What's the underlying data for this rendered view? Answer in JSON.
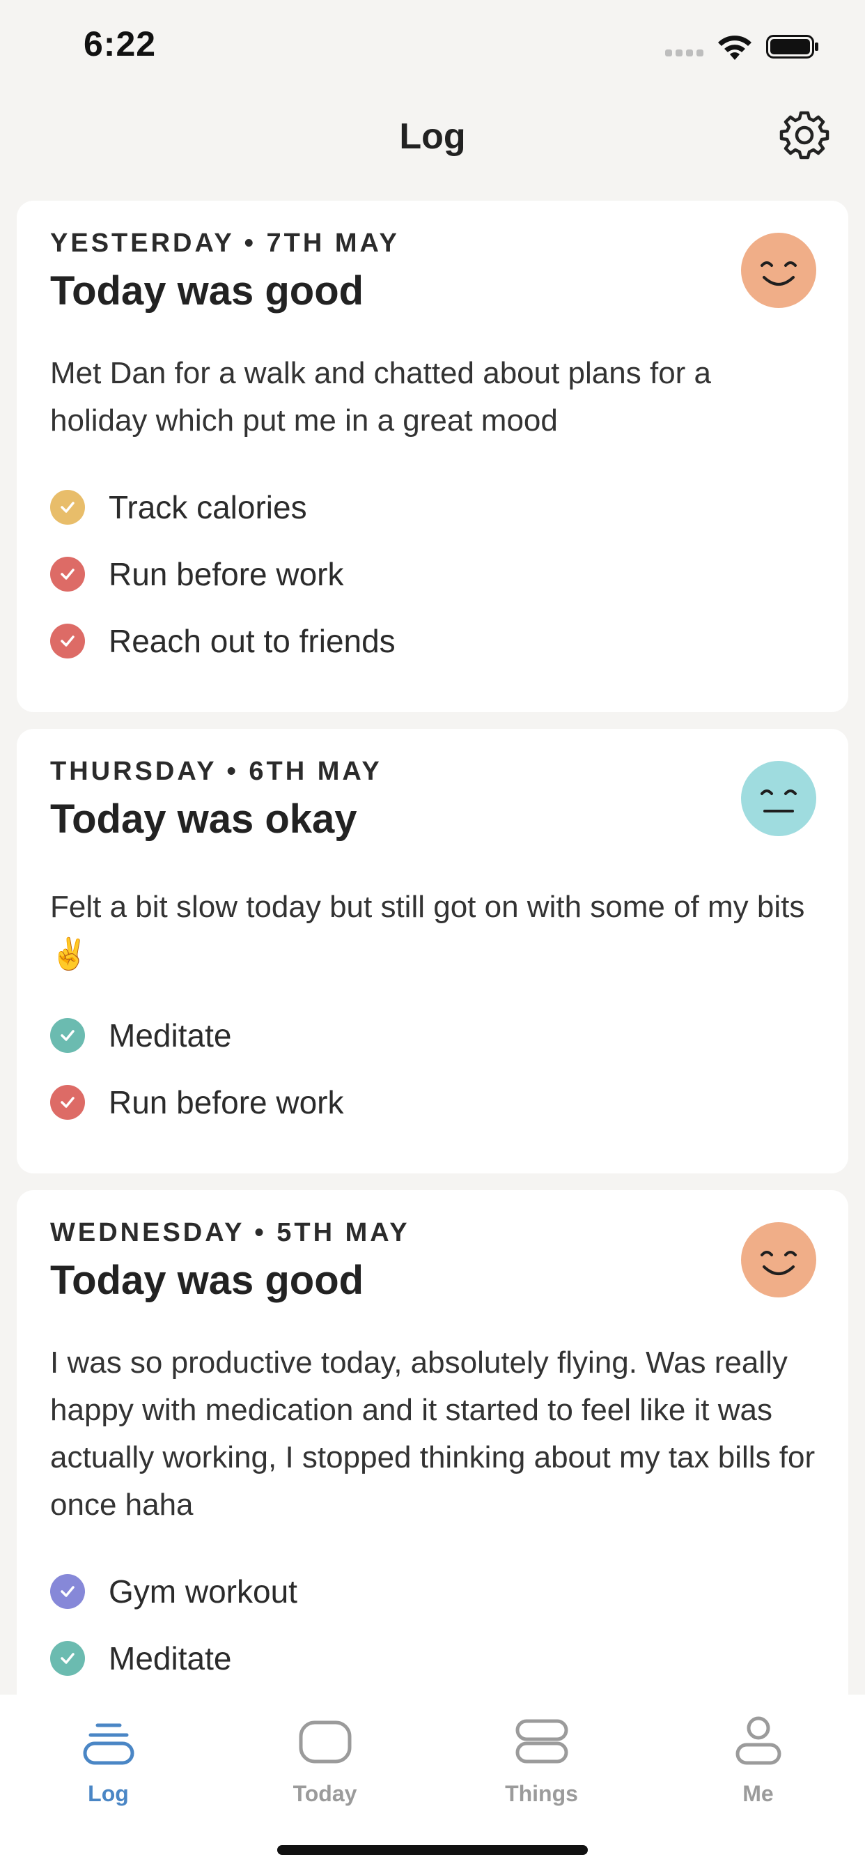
{
  "status_bar": {
    "time": "6:22"
  },
  "header": {
    "title": "Log",
    "settings_icon": "gear-icon"
  },
  "colors": {
    "face_good": "#f0ae88",
    "face_okay": "#9fdcdf",
    "check_yellow": "#e8bd6a",
    "check_red": "#dd6b66",
    "check_teal": "#6bbbb0",
    "check_purple": "#8688d8",
    "accent": "#4a86c5"
  },
  "entries": [
    {
      "date": "YESTERDAY • 7TH MAY",
      "title": "Today was good",
      "mood": "good",
      "note": "Met Dan for a walk and chatted about plans for a holiday which put me in a great mood",
      "habits": [
        {
          "label": "Track calories",
          "color": "yellow"
        },
        {
          "label": "Run before work",
          "color": "red"
        },
        {
          "label": "Reach out to friends",
          "color": "red"
        }
      ]
    },
    {
      "date": "THURSDAY • 6TH MAY",
      "title": "Today was okay",
      "mood": "okay",
      "note": "Felt a bit slow today but still got on with some of my bits ✌️",
      "habits": [
        {
          "label": "Meditate",
          "color": "teal"
        },
        {
          "label": "Run before work",
          "color": "red"
        }
      ]
    },
    {
      "date": "WEDNESDAY • 5TH MAY",
      "title": "Today was good",
      "mood": "good",
      "note": "I was so productive today, absolutely flying. Was really happy with medication and it started to feel like it was actually working, I stopped thinking about my tax bills for once haha",
      "habits": [
        {
          "label": "Gym workout",
          "color": "purple"
        },
        {
          "label": "Meditate",
          "color": "teal"
        }
      ]
    }
  ],
  "tabs": [
    {
      "label": "Log",
      "icon": "log-stack-icon",
      "active": true
    },
    {
      "label": "Today",
      "icon": "today-rounded-square-icon",
      "active": false
    },
    {
      "label": "Things",
      "icon": "things-list-icon",
      "active": false
    },
    {
      "label": "Me",
      "icon": "person-icon",
      "active": false
    }
  ]
}
